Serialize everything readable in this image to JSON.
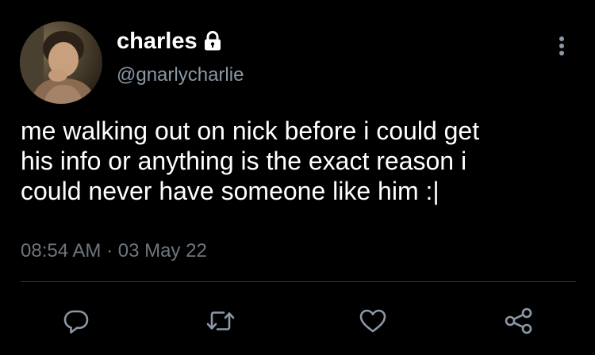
{
  "tweet": {
    "display_name": "charles",
    "handle": "@gnarlycharlie",
    "text": "me walking out on nick before i could get\nhis info or anything is the exact reason i\ncould never have someone like him :|",
    "timestamp": "08:54 AM · 03 May 22"
  },
  "icons": {
    "lock": "lock-icon",
    "more": "more-vertical-icon",
    "reply": "reply-icon",
    "retweet": "retweet-icon",
    "like": "heart-icon",
    "share": "share-icon"
  },
  "colors": {
    "background": "#000000",
    "text_primary": "#ffffff",
    "text_secondary": "#8b98a5",
    "divider": "#2f3336"
  }
}
